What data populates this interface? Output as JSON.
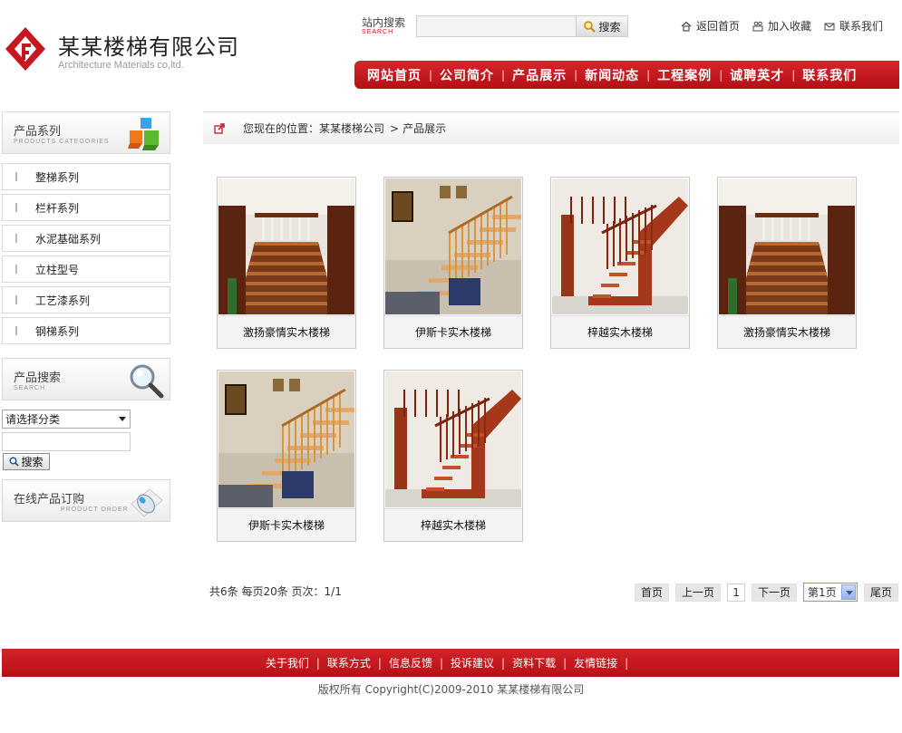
{
  "brand": {
    "name": "某某楼梯有限公司",
    "subtitle": "Architecture Materials co,ltd.",
    "logo_color": "#c7161e"
  },
  "site_search": {
    "title": "站内搜索",
    "subtitle": "SEARCH",
    "button_label": "搜索",
    "value": ""
  },
  "quick_links": [
    {
      "label": "返回首页",
      "icon": "home-icon"
    },
    {
      "label": "加入收藏",
      "icon": "bookmark-icon"
    },
    {
      "label": "联系我们",
      "icon": "mail-icon"
    }
  ],
  "nav": {
    "items": [
      "网站首页",
      "公司简介",
      "产品展示",
      "新闻动态",
      "工程案例",
      "诚聘英才",
      "联系我们"
    ],
    "separator": "|",
    "color": "#c7161e"
  },
  "sidebar": {
    "categories_title": "产品系列",
    "categories_subtitle": "PRODUCTS CATEGORIES",
    "categories": [
      "整梯系列",
      "栏杆系列",
      "水泥基础系列",
      "立柱型号",
      "工艺漆系列",
      "钢梯系列"
    ],
    "search_title": "产品搜索",
    "search_subtitle": "SEARCH",
    "search_select": "请选择分类",
    "search_input": "",
    "search_button": "搜索",
    "order_title": "在线产品订购",
    "order_subtitle": "PRODUCT ORDER"
  },
  "breadcrumb": {
    "prefix": "您现在的位置：",
    "home": "某某楼梯公司",
    "separator": ">",
    "current": "产品展示"
  },
  "products": [
    {
      "name": "激扬豪情实木楼梯",
      "style": "classic"
    },
    {
      "name": "伊斯卡实木楼梯",
      "style": "modern"
    },
    {
      "name": "梓越实木楼梯",
      "style": "red"
    },
    {
      "name": "激扬豪情实木楼梯",
      "style": "classic"
    },
    {
      "name": "伊斯卡实木楼梯",
      "style": "modern"
    },
    {
      "name": "梓越实木楼梯",
      "style": "red"
    }
  ],
  "pagination": {
    "info": "共6条  每页20条  页次：1/1",
    "first": "首页",
    "prev": "上一页",
    "current_page": "1",
    "next": "下一页",
    "select_value": "第1页",
    "last": "尾页"
  },
  "footer": {
    "links": [
      "关于我们",
      "联系方式",
      "信息反馈",
      "投诉建议",
      "资料下载",
      "友情链接"
    ],
    "separator": "|",
    "copyright": "版权所有  Copyright(C)2009-2010 某某楼梯有限公司"
  }
}
